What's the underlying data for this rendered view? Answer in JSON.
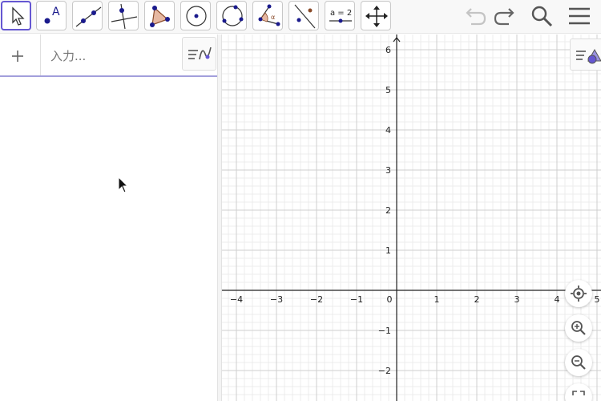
{
  "toolbar": {
    "tools": [
      {
        "name": "move-tool",
        "active": true
      },
      {
        "name": "point-tool",
        "glyph": "A"
      },
      {
        "name": "line-tool"
      },
      {
        "name": "perpendicular-line-tool"
      },
      {
        "name": "polygon-tool"
      },
      {
        "name": "circle-center-point-tool"
      },
      {
        "name": "circle-three-points-tool"
      },
      {
        "name": "angle-tool",
        "glyph": "α"
      },
      {
        "name": "reflect-tool"
      },
      {
        "name": "slider-tool",
        "glyph": "a = 2"
      },
      {
        "name": "move-graphics-view-tool"
      }
    ],
    "right": [
      "undo",
      "redo",
      "search",
      "menu"
    ]
  },
  "algebra": {
    "add_label": "+",
    "input_placeholder": "入力..."
  },
  "graphics": {
    "x_ticks": [
      "−4",
      "−3",
      "−2",
      "−1",
      "0",
      "1",
      "2",
      "3",
      "4",
      "5"
    ],
    "y_ticks": [
      "6",
      "5",
      "4",
      "3",
      "2",
      "1",
      "−1",
      "−2"
    ],
    "buttons": [
      "standard-view",
      "zoom-in",
      "zoom-out",
      "fullscreen"
    ]
  },
  "colors": {
    "accent": "#6557d2",
    "point_blue": "#1a1a8c",
    "polygon_fill": "#e6b8a2"
  }
}
